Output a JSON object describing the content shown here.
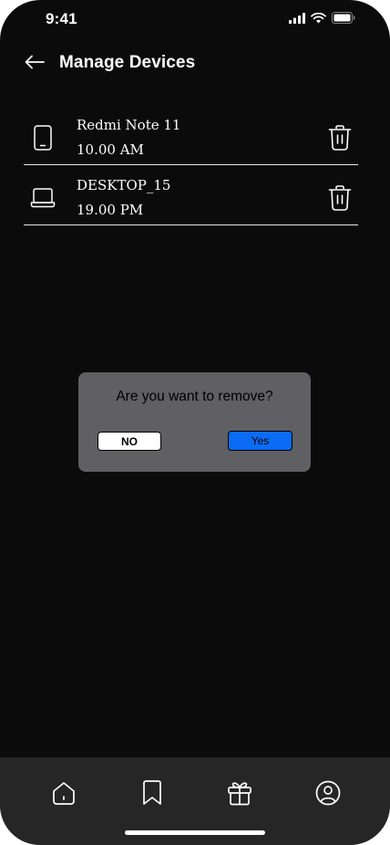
{
  "status_bar": {
    "time": "9:41",
    "icons": [
      "cellular-signal-icon",
      "wifi-icon",
      "battery-icon"
    ]
  },
  "header": {
    "back_icon": "arrow-left-icon",
    "title": "Manage Devices"
  },
  "devices": [
    {
      "name": "Redmi Note 11",
      "time": "10.00 AM",
      "icon": "smartphone-icon",
      "action_icon": "trash-icon"
    },
    {
      "name": "DESKTOP_15",
      "time": "19.00 PM",
      "icon": "laptop-icon",
      "action_icon": "trash-icon"
    }
  ],
  "dialog": {
    "question": "Are you want to remove?",
    "no_label": "NO",
    "yes_label": "Yes"
  },
  "bottom_nav": {
    "items": [
      "home-icon",
      "bookmark-icon",
      "gift-icon",
      "profile-icon"
    ]
  },
  "colors": {
    "background": "#0b0b0b",
    "dialog_bg": "#5f5f64",
    "yes_button": "#0a6cf5",
    "nav_bg": "#262626"
  }
}
